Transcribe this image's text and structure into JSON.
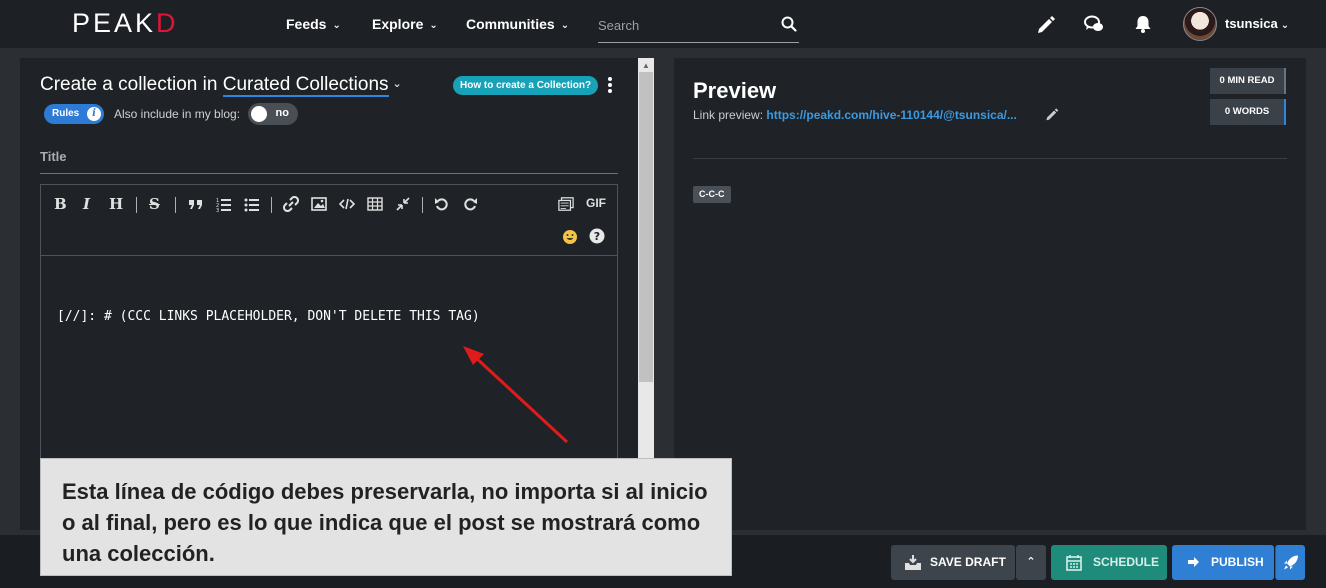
{
  "nav": {
    "logo_main": "PEAK",
    "logo_end": "D",
    "items": [
      {
        "label": "Feeds"
      },
      {
        "label": "Explore"
      },
      {
        "label": "Communities"
      }
    ],
    "search_placeholder": "Search",
    "username": "tsunsica"
  },
  "editor": {
    "create_prefix": "Create a collection in ",
    "community": "Curated Collections",
    "howto_button": "How to create a Collection?",
    "rules_label": "Rules",
    "also_include_label": "Also include in my blog:",
    "toggle_value": "no",
    "title_label": "Title",
    "toolbar_gif": "GIF",
    "content": "[//]: # (CCC LINKS PLACEHOLDER, DON'T DELETE THIS TAG)"
  },
  "preview": {
    "title": "Preview",
    "link_label": "Link preview: ",
    "link_url": "https://peakd.com/hive-110144/@tsunsica/...",
    "min_read": "0 MIN READ",
    "words": "0 WORDS",
    "tag": "c-c-c"
  },
  "actions": {
    "save_draft": "SAVE DRAFT",
    "schedule": "SCHEDULE",
    "publish": "PUBLISH"
  },
  "annotation": {
    "text": "Esta línea de código debes preservarla, no importa si al inicio o al final, pero es lo que indica que el post se mostrará como una colección."
  },
  "colors": {
    "brand_red": "#e31337",
    "accent_blue": "#2e86de",
    "teal": "#17a2b8",
    "schedule_green": "#1f8b7a",
    "annotation_arrow": "#e01b1b"
  }
}
